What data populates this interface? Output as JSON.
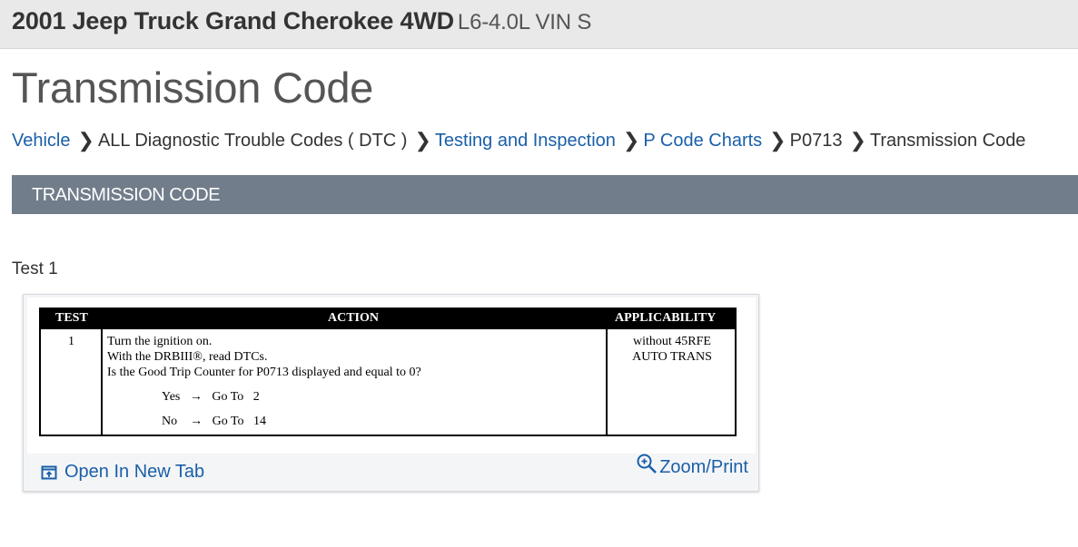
{
  "header": {
    "vehicle": "2001 Jeep Truck Grand Cherokee 4WD",
    "engine": "L6-4.0L VIN S"
  },
  "page_title": "Transmission Code",
  "breadcrumb": {
    "items": [
      "Vehicle",
      "ALL Diagnostic Trouble Codes ( DTC )",
      "Testing and Inspection",
      "P Code Charts",
      "P0713",
      "Transmission Code"
    ],
    "separator": "❯"
  },
  "section": {
    "title": "TRANSMISSION CODE"
  },
  "test_label": "Test 1",
  "figure": {
    "headers": {
      "test": "TEST",
      "action": "ACTION",
      "applicability": "APPLICABILITY"
    },
    "row": {
      "test": "1",
      "action_lines": [
        "Turn the ignition on.",
        "With the DRBIII®, read DTCs.",
        "Is the Good Trip Counter for P0713 displayed and equal to 0?"
      ],
      "yes_label": "Yes",
      "yes_goto": "Go To   2",
      "no_label": "No",
      "no_goto": "Go To   14",
      "arrow": "→",
      "applicability_lines": [
        "without 45RFE",
        "AUTO TRANS"
      ]
    }
  },
  "footer": {
    "open_label": "Open In New Tab",
    "zoom_label": "Zoom/Print"
  },
  "colors": {
    "link": "#1a5fa8",
    "section_bg": "#717d8a",
    "topbar_bg": "#e9e9ea"
  },
  "icons": {
    "open": "open-new-tab-icon",
    "zoom": "zoom-in-icon"
  }
}
